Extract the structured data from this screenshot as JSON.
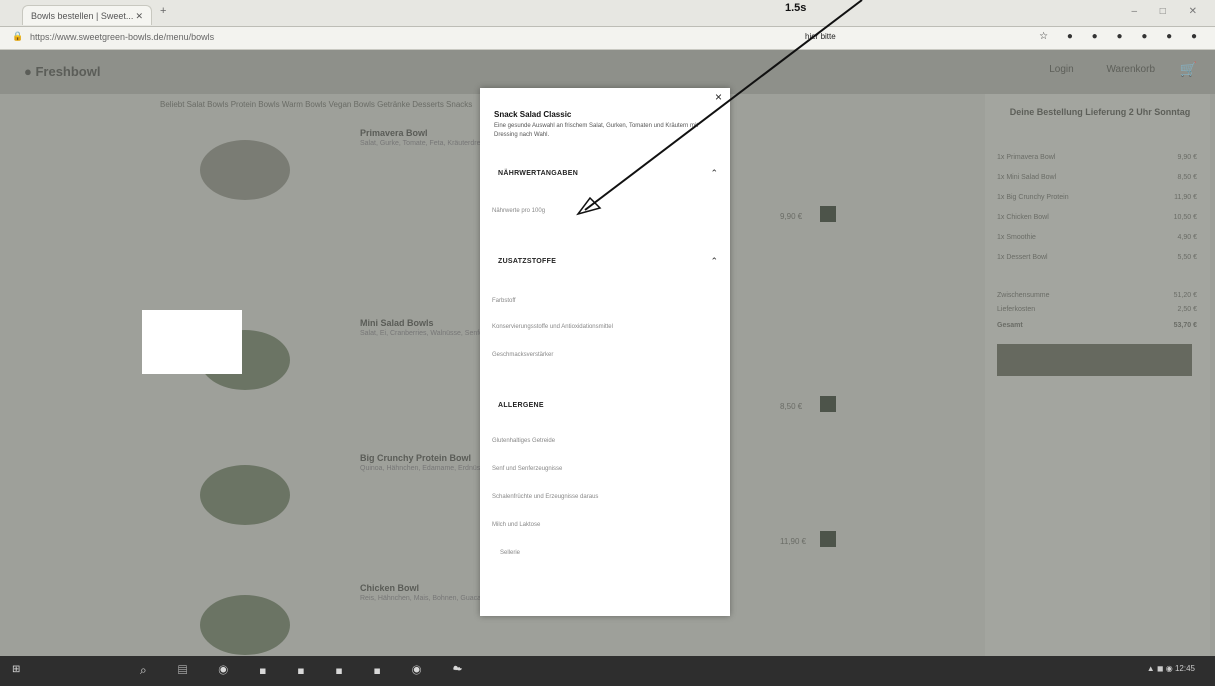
{
  "browser": {
    "tab_title": "Bowls bestellen | Sweet...",
    "tab_close": "✕",
    "new_tab": "+",
    "url": "https://www.sweetgreen-bowls.de/menu/bowls",
    "window_controls": "– □ ✕",
    "extensions": "☆ ● ● ● ● ● ●"
  },
  "annotation": {
    "note_line1": "1.5s",
    "note_line2": "hier bitte"
  },
  "site": {
    "logo": "● Freshbowl",
    "header_links": "Login Warenkorb",
    "cart_icon": "🛒",
    "category_nav": "Beliebt   Salat Bowls   Protein Bowls   Warm Bowls   Vegan Bowls   Getränke   Desserts   Snacks"
  },
  "products": [
    {
      "name": "Primavera Bowl",
      "desc": "Salat, Gurke, Tomate, Feta, Kräuterdressing",
      "price": "9,90 €"
    },
    {
      "name": "Mini Salad Bowls",
      "desc": "Salat, Ei, Cranberries, Walnüsse, Senfdressing",
      "price": "8,50 €"
    },
    {
      "name": "Big Crunchy Protein Bowl",
      "desc": "Quinoa, Hähnchen, Edamame, Erdnüsse, Sesam",
      "price": "11,90 €"
    },
    {
      "name": "Chicken Bowl",
      "desc": "Reis, Hähnchen, Mais, Bohnen, Guacamole",
      "price": ""
    }
  ],
  "sidebar": {
    "title": "Deine Bestellung Lieferung 2 Uhr Sonntag",
    "items": [
      {
        "label": "1x Primavera Bowl",
        "price": "9,90 €"
      },
      {
        "label": "1x Mini Salad Bowl",
        "price": "8,50 €"
      },
      {
        "label": "1x Big Crunchy Protein",
        "price": "11,90 €"
      },
      {
        "label": "1x Chicken Bowl",
        "price": "10,50 €"
      },
      {
        "label": "1x Smoothie",
        "price": "4,90 €"
      },
      {
        "label": "1x Dessert Bowl",
        "price": "5,50 €"
      }
    ],
    "subtotal_label": "Zwischensumme",
    "subtotal": "51,20 €",
    "delivery_label": "Lieferkosten",
    "delivery": "2,50 €",
    "total_label": "Gesamt",
    "total": "53,70 €"
  },
  "modal": {
    "close": "×",
    "title": "Snack Salad Classic",
    "desc": "Eine gesunde Auswahl an frischem Salat, Gurken, Tomaten und Kräutern mit Dressing nach Wahl.",
    "sections": [
      {
        "title": "NÄHRWERTANGABEN",
        "chevron": "⌃"
      },
      {
        "title": "ZUSATZSTOFFE",
        "chevron": "⌃"
      },
      {
        "title": "ALLERGENE",
        "chevron": ""
      }
    ],
    "naehrwert_rows": [
      "Nährwerte pro 100g"
    ],
    "zusatz_rows": [
      "Farbstoff",
      "Konservierungsstoffe und Antioxidationsmittel",
      "Geschmacksverstärker"
    ],
    "allergen_rows": [
      "Glutenhaltiges Getreide",
      "Senf und Senferzeugnisse",
      "Schalenfrüchte und Erzeugnisse daraus",
      "Milch und Laktose",
      "Sellerie"
    ]
  },
  "taskbar": {
    "start": "⊞",
    "icons": "⌕ ▤ ◉ ◼ ◼ ◼ ◼ ◉ ☁",
    "tray": "▲ ◼ ◉ 12:45"
  }
}
